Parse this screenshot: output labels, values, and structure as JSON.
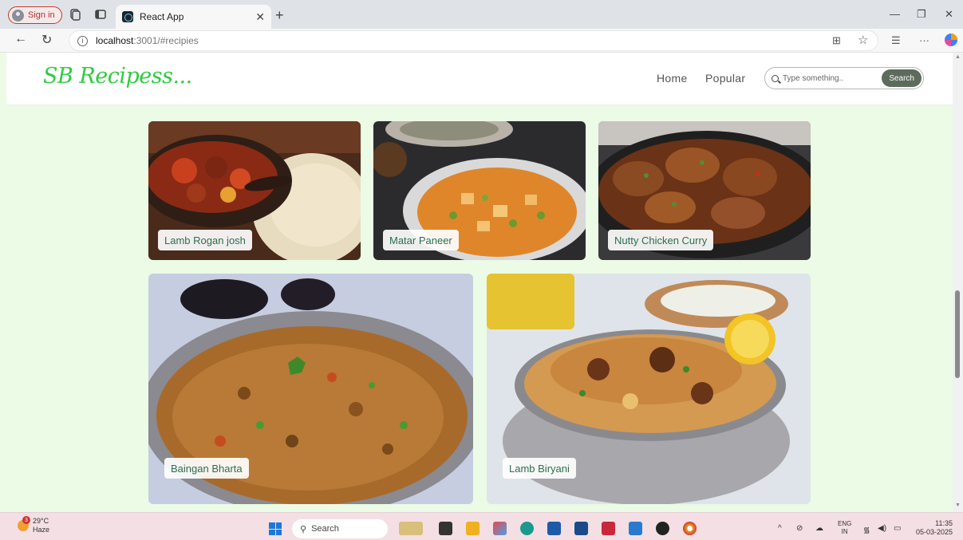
{
  "browser": {
    "signin_label": "Sign in",
    "tab_title": "React App",
    "url_host": "localhost",
    "url_path": ":3001/#recipies"
  },
  "site": {
    "logo": "SB Recipess...",
    "nav": [
      "Home",
      "Popular"
    ],
    "search_placeholder": "Type something..",
    "search_button": "Search"
  },
  "recipes": [
    {
      "name": "Lamb Rogan josh"
    },
    {
      "name": "Matar Paneer"
    },
    {
      "name": "Nutty Chicken Curry"
    },
    {
      "name": "Baingan Bharta"
    },
    {
      "name": "Lamb Biryani"
    }
  ],
  "taskbar": {
    "temperature": "29°C",
    "weather": "Haze",
    "weather_badge": "3",
    "search_label": "Search",
    "lang_top": "ENG",
    "lang_bottom": "IN",
    "time": "11:35",
    "date": "05-03-2025"
  },
  "colors": {
    "page_bg": "#ebfbe6",
    "logo": "#2ecc40",
    "label_text": "#2d6e4e",
    "search_button": "#5d6b5d"
  }
}
